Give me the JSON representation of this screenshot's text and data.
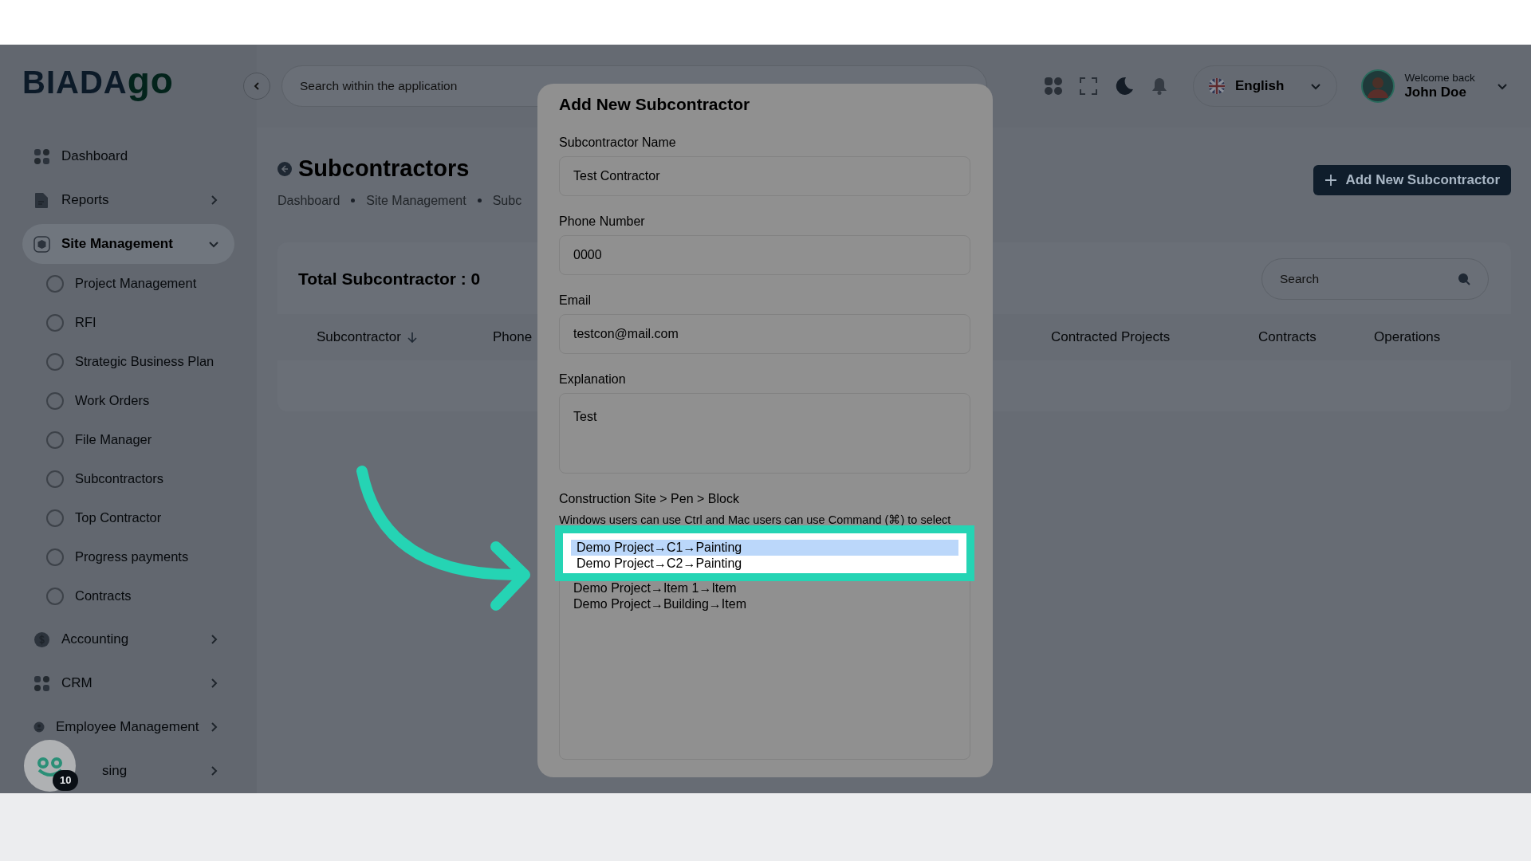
{
  "sidebar": {
    "logo": {
      "main": "BIADA",
      "accent": "go"
    },
    "items": [
      {
        "label": "Dashboard",
        "has_submenu": false,
        "expanded": false,
        "selected": false
      },
      {
        "label": "Reports",
        "has_submenu": true,
        "expanded": false,
        "selected": false
      },
      {
        "label": "Site Management",
        "has_submenu": true,
        "expanded": true,
        "selected": true,
        "children": [
          {
            "label": "Project Management"
          },
          {
            "label": "RFI"
          },
          {
            "label": "Strategic Business Plan"
          },
          {
            "label": "Work Orders"
          },
          {
            "label": "File Manager"
          },
          {
            "label": "Subcontractors"
          },
          {
            "label": "Top Contractor"
          },
          {
            "label": "Progress payments"
          },
          {
            "label": "Contracts"
          }
        ]
      },
      {
        "label": "Accounting",
        "has_submenu": true,
        "expanded": false,
        "selected": false
      },
      {
        "label": "CRM",
        "has_submenu": true,
        "expanded": false,
        "selected": false
      },
      {
        "label": "Employee Management",
        "has_submenu": true,
        "expanded": false,
        "selected": false
      },
      {
        "label": "sing",
        "has_submenu": true,
        "expanded": false,
        "selected": false
      }
    ]
  },
  "help_widget": {
    "badge": "10"
  },
  "header": {
    "search": {
      "placeholder": "Search within the application"
    },
    "language": "English",
    "user": {
      "greeting": "Welcome back",
      "name": "John Doe"
    }
  },
  "page": {
    "title": "Subcontractors",
    "breadcrumb": [
      "Dashboard",
      "Site Management",
      "Subc"
    ],
    "add_button": "Add New Subcontractor",
    "card": {
      "total": "Total Subcontractor : 0",
      "search": {
        "placeholder": "Search"
      },
      "columns": [
        {
          "label": "Subcontractor",
          "sorted": true
        },
        {
          "label": "Phone",
          "sorted": false
        },
        {
          "label": "Contracted Projects",
          "sorted": false
        },
        {
          "label": "Contracts",
          "sorted": false
        },
        {
          "label": "Operations",
          "sorted": false
        }
      ]
    }
  },
  "modal": {
    "title": "Add New Subcontractor",
    "fields": [
      {
        "label": "Subcontractor Name",
        "kind": "input",
        "value": "Test Contractor"
      },
      {
        "label": "Phone Number",
        "kind": "input",
        "value": "0000"
      },
      {
        "label": "Email",
        "kind": "input",
        "value": "testcon@mail.com"
      },
      {
        "label": "Explanation",
        "kind": "textarea",
        "value": "Test"
      }
    ],
    "multi_select": {
      "label": "Construction Site > Pen > Block",
      "hint": "Windows users can use Ctrl and Mac users can use Command (⌘) to select",
      "options": [
        {
          "label": "Demo Project→C1→Painting",
          "selected": true,
          "spotlight": true
        },
        {
          "label": "Demo Project→C2→Painting",
          "selected": false,
          "spotlight": true
        },
        {
          "label": "Demo Project→Item 1→Item",
          "selected": false,
          "spotlight": false
        },
        {
          "label": "Demo Project→Building→Item",
          "selected": false,
          "spotlight": false
        }
      ]
    }
  }
}
